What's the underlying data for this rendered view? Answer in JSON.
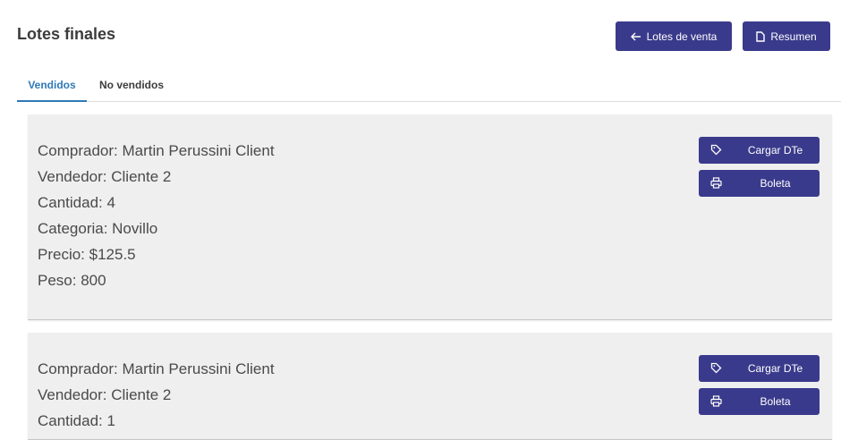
{
  "header": {
    "title": "Lotes finales",
    "back_button": "Lotes de venta",
    "summary_button": "Resumen"
  },
  "tabs": [
    {
      "label": "Vendidos",
      "active": true
    },
    {
      "label": "No vendidos",
      "active": false
    }
  ],
  "lots": [
    {
      "buyer": "Comprador: Martin Perussini Client",
      "seller": "Vendedor: Cliente 2",
      "quantity": "Cantidad: 4",
      "category": "Categoria: Novillo",
      "price": "Precio: $125.5",
      "weight": "Peso: 800",
      "dte_button": "Cargar DTe",
      "boleta_button": "Boleta"
    },
    {
      "buyer": "Comprador: Martin Perussini Client",
      "seller": "Vendedor: Cliente 2",
      "quantity": "Cantidad: 1",
      "dte_button": "Cargar DTe",
      "boleta_button": "Boleta"
    }
  ],
  "icons": {
    "back": "arrow-left-icon",
    "summary": "document-icon",
    "dte": "tag-icon",
    "boleta": "printer-icon"
  },
  "colors": {
    "primary": "#3a3a8c",
    "active_tab": "#2e7ab8",
    "card_background": "#efefef"
  }
}
